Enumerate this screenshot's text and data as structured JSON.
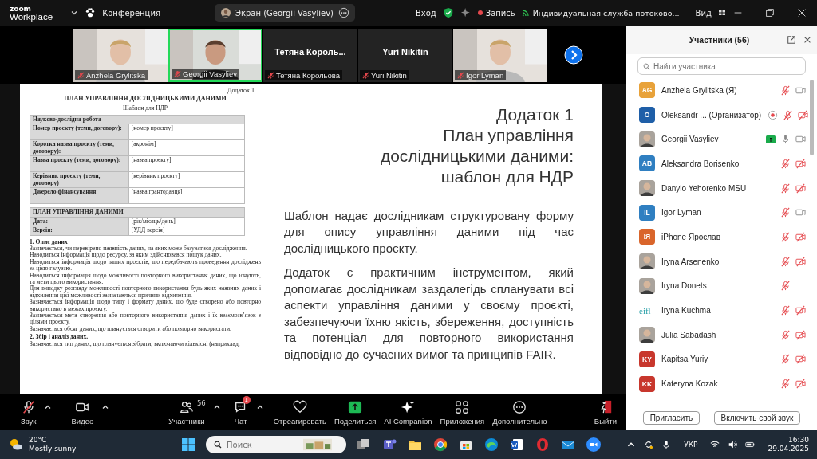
{
  "topbar": {
    "logo_top": "zoom",
    "logo_bottom": "Workplace",
    "meeting": "Конференция",
    "screen_pill": "Экран (Georgii Vasyliev)",
    "signin": "Вход",
    "record": "Запись",
    "stream": "Индивидуальная служба потоково...",
    "view": "Вид"
  },
  "video_strip": [
    {
      "name": "Anzhela Grylitska",
      "speaking": false
    },
    {
      "name": "Georgii Vasyliev",
      "speaking": true
    },
    {
      "kind": "name",
      "title": "Тетяна  Король...",
      "name": "Тетяна Корольова",
      "speaking": false
    },
    {
      "kind": "name",
      "title": "Yuri Nikitin",
      "name": "Yuri Nikitin",
      "speaking": false
    },
    {
      "name": "Igor Lyman",
      "speaking": false
    }
  ],
  "document": {
    "corner": "Додаток 1",
    "heading": "ПЛАН УПРАВЛІННЯ ДОСЛІДНИЦЬКИМИ ДАНИМИ",
    "subheading": "Шаблон для НДР",
    "table1": {
      "header": "Науково-дослідна робота",
      "rows": [
        {
          "label": "Номер проєкту (теми, договору):",
          "value": "[номер проєкту]"
        },
        {
          "label": "Коротка назва проєкту (теми, договору):",
          "value": "[акронім]"
        },
        {
          "label": "Назва проєкту (теми, договору):",
          "value": "[назва проєкту]"
        },
        {
          "label": "Керівник проєкту (теми, договору)",
          "value": "[керівник проєкту]"
        },
        {
          "label": "Джерело фінансування",
          "value": "[назва грантодавця]"
        }
      ]
    },
    "table2": {
      "header": "ПЛАН УПРАВЛІННЯ ДАНИМИ",
      "rows": [
        {
          "label": "Дата:",
          "value": "[рік/місяць/день]"
        },
        {
          "label": "Версія:",
          "value": "[УДД версія]"
        }
      ]
    },
    "sections": [
      {
        "title": "1. Опис даних",
        "lines": [
          "Зазначається, чи перевірено наявність даних, на яких може базуватися дослідження.",
          "Наводиться інформація щодо ресурсу, за яким здійснювався пошук даних.",
          "Наводиться інформація щодо інших проєктів, що передбачають проведення досліджень за цією галуззю.",
          "Наводиться інформація щодо можливості повторного використання даних, що існують, та мети цього використання.",
          "Для випадку розгляду можливості повторного використання будь-яких наявних даних і відхилення цієї можливості зазначаються причини відхилення.",
          "Зазначається інформація щодо типу і формату даних, що буде створено або повторно використано в межах проєкту.",
          "Зазначається мета створення або повторного використання даних і їх взаємозв’язок з цілями проєкту.",
          "Зазначається обсяг даних, що планується створити або повторно використати."
        ]
      },
      {
        "title": "2. Збір і аналіз даних.",
        "lines": [
          "Зазначається тип даних, що планується зібрати, включаючи кількісні (наприклад,"
        ]
      }
    ]
  },
  "slide": {
    "title": [
      "Додаток 1",
      "План управління",
      "дослідницькими даними:",
      "шаблон для НДР"
    ],
    "paragraphs": [
      "Шаблон надає дослідникам структуровану форму для опису управління даними під час дослідницького проєкту.",
      "Додаток є практичним інструментом, який допомагає дослідникам заздалегідь спланувати всі аспекти управління даними у своєму проєкті, забезпечуючи їхню якість, збереження, доступність та потенціал для повторного використання відповідно до сучасних вимог та принципів FAIR."
    ]
  },
  "toolbar": [
    {
      "label": "Звук",
      "caret": true,
      "muted": true
    },
    {
      "label": "Видео",
      "caret": true
    },
    {
      "label": "Участники",
      "caret": true,
      "count": "56"
    },
    {
      "label": "Чат",
      "caret": true,
      "badge": "1"
    },
    {
      "label": "Отреагировать",
      "caret": false
    },
    {
      "label": "Поделиться",
      "caret": false
    },
    {
      "label": "AI Companion",
      "caret": false
    },
    {
      "label": "Приложения",
      "caret": false
    },
    {
      "label": "Дополнительно",
      "caret": false
    },
    {
      "label": "Выйти",
      "caret": false
    }
  ],
  "participants_panel": {
    "title": "Участники (56)",
    "search": {
      "placeholder": "Найти участника"
    },
    "participants": [
      {
        "name": "Anzhela Grylitska (Я)",
        "avatar": {
          "kind": "initials",
          "text": "AG",
          "color": "#e8a23a"
        },
        "muted": true,
        "video_on": true,
        "sharing": false,
        "recording": false
      },
      {
        "name": "Oleksandr ...  (Организатор)",
        "avatar": {
          "kind": "initials",
          "text": "O",
          "color": "#1f5fa8"
        },
        "muted": true,
        "video_on": false,
        "sharing": false,
        "recording": true
      },
      {
        "name": "Georgii Vasyliev",
        "muted": false,
        "video_on": true,
        "sharing": true,
        "recording": false
      },
      {
        "name": "Aleksandra Borisenko",
        "avatar": {
          "kind": "initials",
          "text": "AB",
          "color": "#2f7fc1"
        },
        "muted": true,
        "video_on": false,
        "sharing": false,
        "recording": false
      },
      {
        "name": "Danylo Yehorenko MSU",
        "muted": true,
        "video_on": false,
        "sharing": false,
        "recording": false
      },
      {
        "name": "Igor Lyman",
        "avatar": {
          "kind": "initials",
          "text": "IL",
          "color": "#2f7fc1"
        },
        "muted": true,
        "video_on": true,
        "sharing": false,
        "recording": false
      },
      {
        "name": "iPhone Ярослав",
        "avatar": {
          "kind": "initials",
          "text": "IЯ",
          "color": "#d9652b"
        },
        "muted": true,
        "video_on": false,
        "sharing": false,
        "recording": false
      },
      {
        "name": "Iryna Arsenenko",
        "muted": true,
        "video_on": false,
        "sharing": false,
        "recording": false
      },
      {
        "name": "Iryna Donets",
        "muted": true,
        "sharing": false,
        "recording": false
      },
      {
        "name": "Iryna Kuchma",
        "avatar": {
          "kind": "logo",
          "text": "eifl"
        },
        "muted": true,
        "video_on": false,
        "sharing": false,
        "recording": false
      },
      {
        "name": "Julia Sabadash",
        "muted": true,
        "video_on": false,
        "sharing": false,
        "recording": false
      },
      {
        "name": "Kapitsa Yuriy",
        "avatar": {
          "kind": "initials",
          "text": "KY",
          "color": "#c8372d"
        },
        "muted": true,
        "video_on": false,
        "sharing": false,
        "recording": false
      },
      {
        "name": "Kateryna Kozak",
        "avatar": {
          "kind": "initials",
          "text": "KK",
          "color": "#c8372d"
        },
        "muted": true,
        "video_on": false,
        "sharing": false,
        "recording": false
      }
    ],
    "buttons": [
      "Пригласить",
      "Включить свой звук"
    ]
  },
  "taskbar": {
    "temperature": "20°C",
    "weather": "Mostly sunny",
    "search": {
      "placeholder": "Поиск"
    },
    "language": "УКР",
    "time": "16:30",
    "date": "29.04.2025"
  }
}
